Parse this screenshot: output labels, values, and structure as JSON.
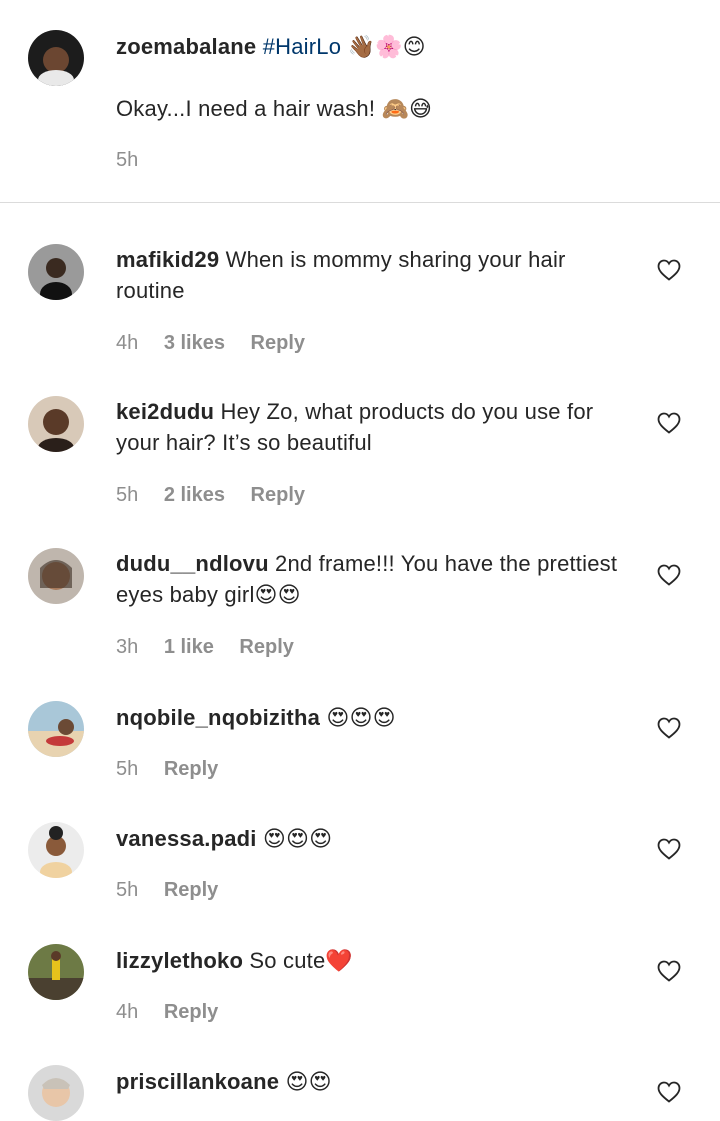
{
  "caption": {
    "username": "zoemabalane",
    "hashtag": "#HairLo",
    "hashtag_emoji": "👋🏾🌸😊",
    "text": "Okay...I need a hair wash!",
    "text_emoji": "🙈😅",
    "time": "5h"
  },
  "comments": [
    {
      "username": "mafikid29",
      "text": "When is mommy sharing your hair routine",
      "emoji": "",
      "time": "4h",
      "likes": "3 likes",
      "reply": "Reply"
    },
    {
      "username": "kei2dudu",
      "text": "Hey Zo, what products do you use for your hair? It’s so beautiful",
      "emoji": "",
      "time": "5h",
      "likes": "2 likes",
      "reply": "Reply"
    },
    {
      "username": "dudu__ndlovu",
      "text": "2nd frame!!! You have the prettiest eyes baby girl",
      "emoji": "😍😍",
      "time": "3h",
      "likes": "1 like",
      "reply": "Reply"
    },
    {
      "username": "nqobile_nqobizitha",
      "text": "",
      "emoji": "😍😍😍",
      "time": "5h",
      "likes": "",
      "reply": "Reply"
    },
    {
      "username": "vanessa.padi",
      "text": "",
      "emoji": "😍😍😍",
      "time": "5h",
      "likes": "",
      "reply": "Reply"
    },
    {
      "username": "lizzylethoko",
      "text": "So cute",
      "emoji": "❤️",
      "time": "4h",
      "likes": "",
      "reply": "Reply"
    },
    {
      "username": "priscillankoane",
      "text": "",
      "emoji": "😍😍",
      "time": "",
      "likes": "",
      "reply": ""
    }
  ],
  "icons": {
    "like": "heart-outline-icon",
    "avatar": "user-avatar"
  },
  "colors": {
    "hashtag": "#00376b",
    "meta": "#8e8e8e",
    "divider": "#dbdbdb"
  }
}
